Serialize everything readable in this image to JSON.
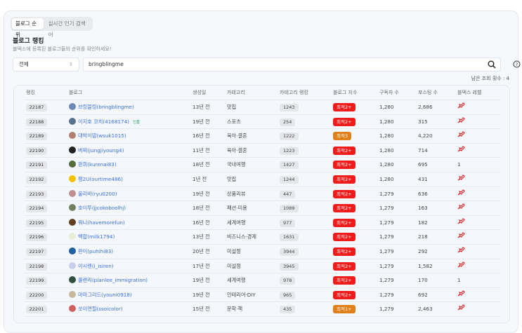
{
  "tabs": [
    "블로그 순위",
    "실시간 인기 검색어"
  ],
  "title": "블로그 랭킹",
  "subtitle": "블덱스에 등록된 블로그들의 순위를 확인하세요!",
  "filter": {
    "selected": "전체"
  },
  "search": {
    "value": "bringblingme"
  },
  "remaining": "남은 조회 횟수 : 4",
  "columns": [
    "랭킹",
    "블로그",
    "생성일",
    "카테고리",
    "카테고리 랭킹",
    "블로그 지수",
    "구독자 수",
    "포스팅 수",
    "블덱스 레벨"
  ],
  "colors": {
    "red": "#f01c1c",
    "orange": "#e0801a",
    "link": "#3b6fe0"
  },
  "rows": [
    {
      "rank": "22187",
      "blog": "브링블링(bringblingme)",
      "age": "13년 전",
      "cat": "맛집",
      "crank": "1243",
      "idx": "최적2+",
      "idxColor": "#f01c1c",
      "sub": "1,280",
      "posts": "2,686",
      "level": "icon",
      "av": "#6a8ab0"
    },
    {
      "rank": "22188",
      "blog": "이지호 코치(4168174)",
      "badge": "인플",
      "age": "19년 전",
      "cat": "스포츠",
      "crank": "254",
      "idx": "최적2+",
      "idxColor": "#f01c1c",
      "sub": "1,280",
      "posts": "315",
      "level": "icon",
      "av": "#5a7090"
    },
    {
      "rank": "22189",
      "blog": "대박이맘(wsuk1015)",
      "age": "16년 전",
      "cat": "육아·결혼",
      "crank": "1222",
      "idx": "최적3",
      "idxColor": "#e0801a",
      "sub": "1,280",
      "posts": "4,220",
      "level": "icon",
      "av": "#b08070"
    },
    {
      "rank": "22190",
      "blog": "버찌(jungjiyoung4)",
      "age": "11년 전",
      "cat": "육아·결혼",
      "crank": "1223",
      "idx": "최적2+",
      "idxColor": "#f01c1c",
      "sub": "1,280",
      "posts": "714",
      "level": "icon",
      "av": "#222"
    },
    {
      "rank": "22191",
      "blog": "환희(kurenai83)",
      "age": "18년 전",
      "cat": "국내여행",
      "crank": "1427",
      "idx": "최적2+",
      "idxColor": "#f01c1c",
      "sub": "1,280",
      "posts": "695",
      "level": "1",
      "av": "#556b3a"
    },
    {
      "rank": "22192",
      "blog": "평2U(ourtime486)",
      "age": "1년 전",
      "cat": "맛집",
      "crank": "1244",
      "idx": "최적2+",
      "idxColor": "#f01c1c",
      "sub": "1,280",
      "posts": "431",
      "level": "icon",
      "av": "#f5c000"
    },
    {
      "rank": "22193",
      "blog": "올리바(ryu0200)",
      "age": "19년 전",
      "cat": "상품리뷰",
      "crank": "447",
      "idx": "최적2+",
      "idxColor": "#f01c1c",
      "sub": "1,279",
      "posts": "636",
      "level": "icon",
      "av": "#c09090"
    },
    {
      "rank": "22194",
      "blog": "호이뚜(jjcokoboolhj)",
      "age": "18년 전",
      "cat": "패션·미용",
      "crank": "1089",
      "idx": "최적2+",
      "idxColor": "#f01c1c",
      "sub": "1,279",
      "posts": "163",
      "level": "icon",
      "av": "#708060"
    },
    {
      "rank": "22195",
      "blog": "워니(havemorefun)",
      "age": "16년 전",
      "cat": "세계여행",
      "crank": "977",
      "idx": "최적2+",
      "idxColor": "#f01c1c",
      "sub": "1,279",
      "posts": "182",
      "level": "icon",
      "av": "#604020"
    },
    {
      "rank": "22196",
      "blog": "백합(milk1794)",
      "age": "13년 전",
      "cat": "비즈니스·경제",
      "crank": "1631",
      "idx": "최적2+",
      "idxColor": "#f01c1c",
      "sub": "1,279",
      "posts": "218",
      "level": "icon",
      "av": "#e8ecd8"
    },
    {
      "rank": "22197",
      "blog": "판이(puhihi83)",
      "age": "20년 전",
      "cat": "미설정",
      "crank": "3944",
      "idx": "최적2+",
      "idxColor": "#f01c1c",
      "sub": "1,279",
      "posts": "292",
      "level": "icon",
      "av": "#2060a0"
    },
    {
      "rank": "22198",
      "blog": "이시렌(i_isiren)",
      "age": "17년 전",
      "cat": "미설정",
      "crank": "3945",
      "idx": "최적2+",
      "idxColor": "#f01c1c",
      "sub": "1,279",
      "posts": "1,582",
      "level": "icon",
      "av": "#c8d0e8"
    },
    {
      "rank": "22199",
      "blog": "플랜리(planlee_immigration)",
      "age": "19년 전",
      "cat": "세계여행",
      "crank": "978",
      "idx": "최적2+",
      "idxColor": "#f01c1c",
      "sub": "1,279",
      "posts": "170",
      "level": "1",
      "av": "#305040"
    },
    {
      "rank": "22200",
      "blog": "마마그리드(youni0918)",
      "age": "19년 전",
      "cat": "인테리어·DIY",
      "crank": "965",
      "idx": "최적2+",
      "idxColor": "#f01c1c",
      "sub": "1,279",
      "posts": "692",
      "level": "icon",
      "av": "#c8b8a0"
    },
    {
      "rank": "22201",
      "blog": "쏘이연필(ssoicolor)",
      "age": "15년 전",
      "cat": "문학·책",
      "crank": "435",
      "idx": "최적1+",
      "idxColor": "#e0801a",
      "sub": "1,279",
      "posts": "2,463",
      "level": "icon",
      "av": "#d06060"
    }
  ]
}
